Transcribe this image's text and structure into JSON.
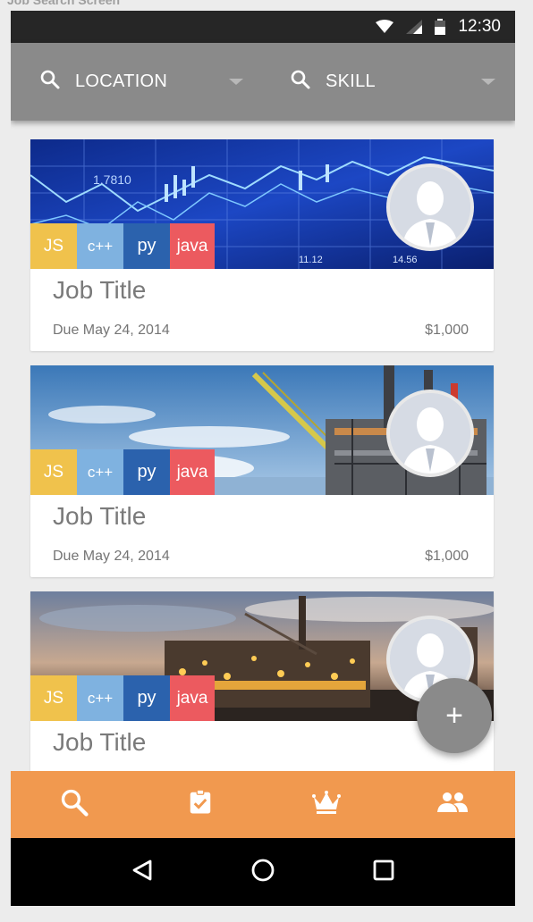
{
  "screen_caption": "Job Search Screen",
  "status_bar": {
    "time": "12:30"
  },
  "search": {
    "location_label": "LOCATION",
    "skill_label": "SKILL"
  },
  "cards": [
    {
      "title": "Job Title",
      "due": "Due May 24, 2014",
      "pay": "$1,000",
      "tags": [
        "JS",
        "c++",
        "py",
        "java"
      ]
    },
    {
      "title": "Job Title",
      "due": "Due May 24, 2014",
      "pay": "$1,000",
      "tags": [
        "JS",
        "c++",
        "py",
        "java"
      ]
    },
    {
      "title": "Job Title",
      "tags": [
        "JS",
        "c++",
        "py",
        "java"
      ]
    }
  ],
  "fab": {
    "label": "+"
  },
  "bottom_nav": {
    "items": [
      "search-icon",
      "assignment-check-icon",
      "crown-icon",
      "people-icon"
    ]
  },
  "android_nav": {
    "items": [
      "back-icon",
      "home-icon",
      "recents-icon"
    ]
  },
  "colors": {
    "status_bar": "#262626",
    "search_bar": "#8a8a8a",
    "bottom_nav": "#f1994f",
    "tag_js": "#f0c24c",
    "tag_cpp": "#7fb2e0",
    "tag_py": "#2b62ad",
    "tag_java": "#ec5a5f",
    "fab": "#8a8a8a"
  }
}
